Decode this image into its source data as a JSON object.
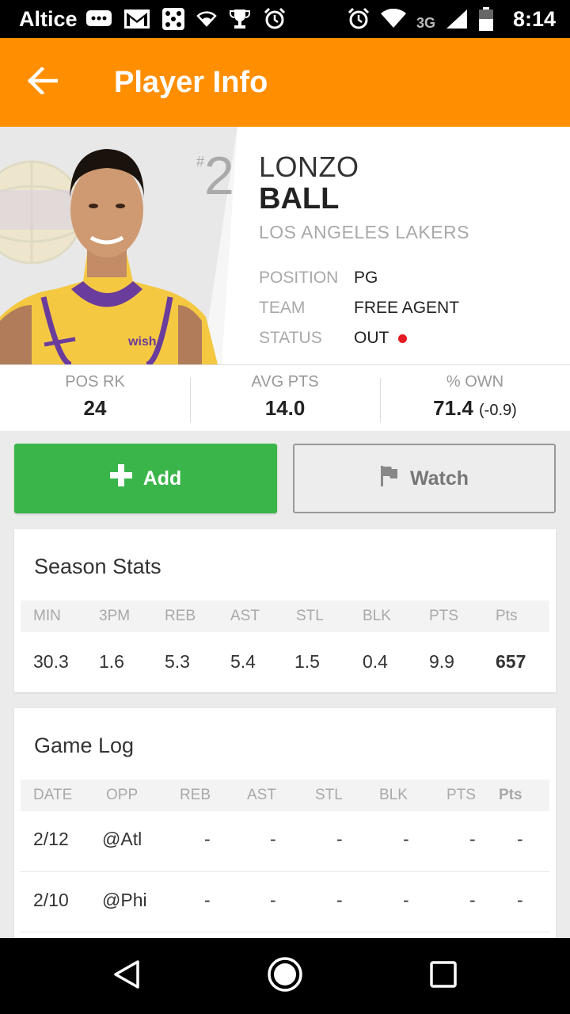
{
  "status_bar": {
    "carrier": "Altice",
    "network": "3G",
    "time": "8:14",
    "icons": [
      "messages-icon",
      "gmail-icon",
      "dice-icon",
      "wifi-small-icon",
      "trophy-icon",
      "alarm-icon",
      "alarm-icon",
      "wifi-icon",
      "signal-icon",
      "battery-icon"
    ]
  },
  "app_bar": {
    "title": "Player Info",
    "back_icon": "arrow-back-icon",
    "color": "#ff8f00"
  },
  "player": {
    "number_prefix": "#",
    "number": "2",
    "first_name": "LONZO",
    "last_name": "BALL",
    "team_full": "LOS ANGELES LAKERS",
    "info": [
      {
        "label": "POSITION",
        "value": "PG"
      },
      {
        "label": "TEAM",
        "value": "FREE AGENT"
      },
      {
        "label": "STATUS",
        "value": "OUT"
      }
    ],
    "status_color": "#e31b23",
    "jersey_text": "wish"
  },
  "summary": [
    {
      "label": "POS RK",
      "value": "24",
      "change": ""
    },
    {
      "label": "AVG PTS",
      "value": "14.0",
      "change": ""
    },
    {
      "label": "% OWN",
      "value": "71.4",
      "change": "(-0.9)"
    }
  ],
  "actions": {
    "add_label": "Add",
    "add_icon": "plus-icon",
    "add_color": "#3ab54a",
    "watch_label": "Watch",
    "watch_icon": "flag-icon"
  },
  "season_stats": {
    "title": "Season Stats",
    "columns": [
      "MIN",
      "3PM",
      "REB",
      "AST",
      "STL",
      "BLK",
      "PTS",
      "Pts"
    ],
    "values": [
      "30.3",
      "1.6",
      "5.3",
      "5.4",
      "1.5",
      "0.4",
      "9.9",
      "657"
    ]
  },
  "game_log": {
    "title": "Game Log",
    "columns": [
      "DATE",
      "OPP",
      "REB",
      "AST",
      "STL",
      "BLK",
      "PTS",
      "Pts"
    ],
    "rows": [
      {
        "date": "2/12",
        "opp": "@Atl",
        "reb": "-",
        "ast": "-",
        "stl": "-",
        "blk": "-",
        "pts": "-",
        "fpts": "-"
      },
      {
        "date": "2/10",
        "opp": "@Phi",
        "reb": "-",
        "ast": "-",
        "stl": "-",
        "blk": "-",
        "pts": "-",
        "fpts": "-"
      }
    ]
  },
  "nav_bar": {
    "icons": [
      "back-triangle-icon",
      "home-circle-icon",
      "recents-square-icon"
    ]
  }
}
